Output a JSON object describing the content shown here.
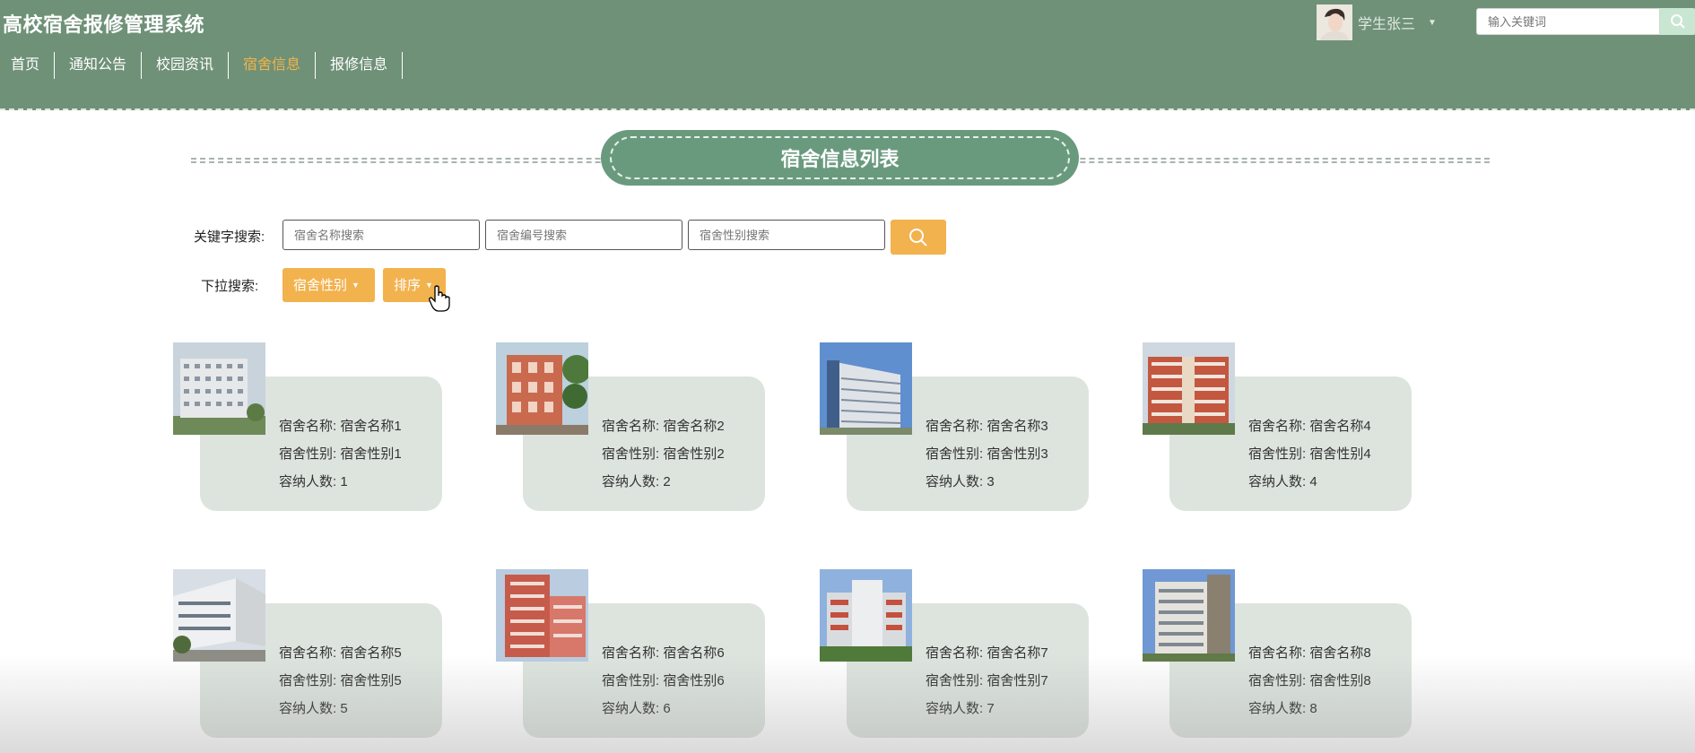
{
  "header": {
    "site_title": "高校宿舍报修管理系统",
    "nav": [
      {
        "label": "首页",
        "active": false
      },
      {
        "label": "通知公告",
        "active": false
      },
      {
        "label": "校园资讯",
        "active": false
      },
      {
        "label": "宿舍信息",
        "active": true
      },
      {
        "label": "报修信息",
        "active": false
      }
    ],
    "user_name": "学生张三",
    "search_placeholder": "输入关键词",
    "active_color": "#f0b34a"
  },
  "section_title": "宿舍信息列表",
  "search": {
    "keyword_label": "关键字搜索:",
    "placeholders": [
      "宿舍名称搜索",
      "宿舍编号搜索",
      "宿舍性别搜索"
    ],
    "dropdown_label": "下拉搜索:",
    "dropdowns": [
      "宿舍性别",
      "排序"
    ],
    "button_color": "#f2b24d"
  },
  "cards": [
    {
      "name_label": "宿舍名称:",
      "name": "宿舍名称1",
      "gender_label": "宿舍性别:",
      "gender": "宿舍性别1",
      "capacity_label": "容纳人数:",
      "capacity": "1"
    },
    {
      "name_label": "宿舍名称:",
      "name": "宿舍名称2",
      "gender_label": "宿舍性别:",
      "gender": "宿舍性别2",
      "capacity_label": "容纳人数:",
      "capacity": "2"
    },
    {
      "name_label": "宿舍名称:",
      "name": "宿舍名称3",
      "gender_label": "宿舍性别:",
      "gender": "宿舍性别3",
      "capacity_label": "容纳人数:",
      "capacity": "3"
    },
    {
      "name_label": "宿舍名称:",
      "name": "宿舍名称4",
      "gender_label": "宿舍性别:",
      "gender": "宿舍性别4",
      "capacity_label": "容纳人数:",
      "capacity": "4"
    },
    {
      "name_label": "宿舍名称:",
      "name": "宿舍名称5",
      "gender_label": "宿舍性别:",
      "gender": "宿舍性别5",
      "capacity_label": "容纳人数:",
      "capacity": "5"
    },
    {
      "name_label": "宿舍名称:",
      "name": "宿舍名称6",
      "gender_label": "宿舍性别:",
      "gender": "宿舍性别6",
      "capacity_label": "容纳人数:",
      "capacity": "6"
    },
    {
      "name_label": "宿舍名称:",
      "name": "宿舍名称7",
      "gender_label": "宿舍性别:",
      "gender": "宿舍性别7",
      "capacity_label": "容纳人数:",
      "capacity": "7"
    },
    {
      "name_label": "宿舍名称:",
      "name": "宿舍名称8",
      "gender_label": "宿舍性别:",
      "gender": "宿舍性别8",
      "capacity_label": "容纳人数:",
      "capacity": "8"
    }
  ],
  "icons": {
    "search": "search-icon",
    "caret": "caret-down-icon",
    "avatar": "user-avatar",
    "cursor": "hand-pointer-icon"
  }
}
